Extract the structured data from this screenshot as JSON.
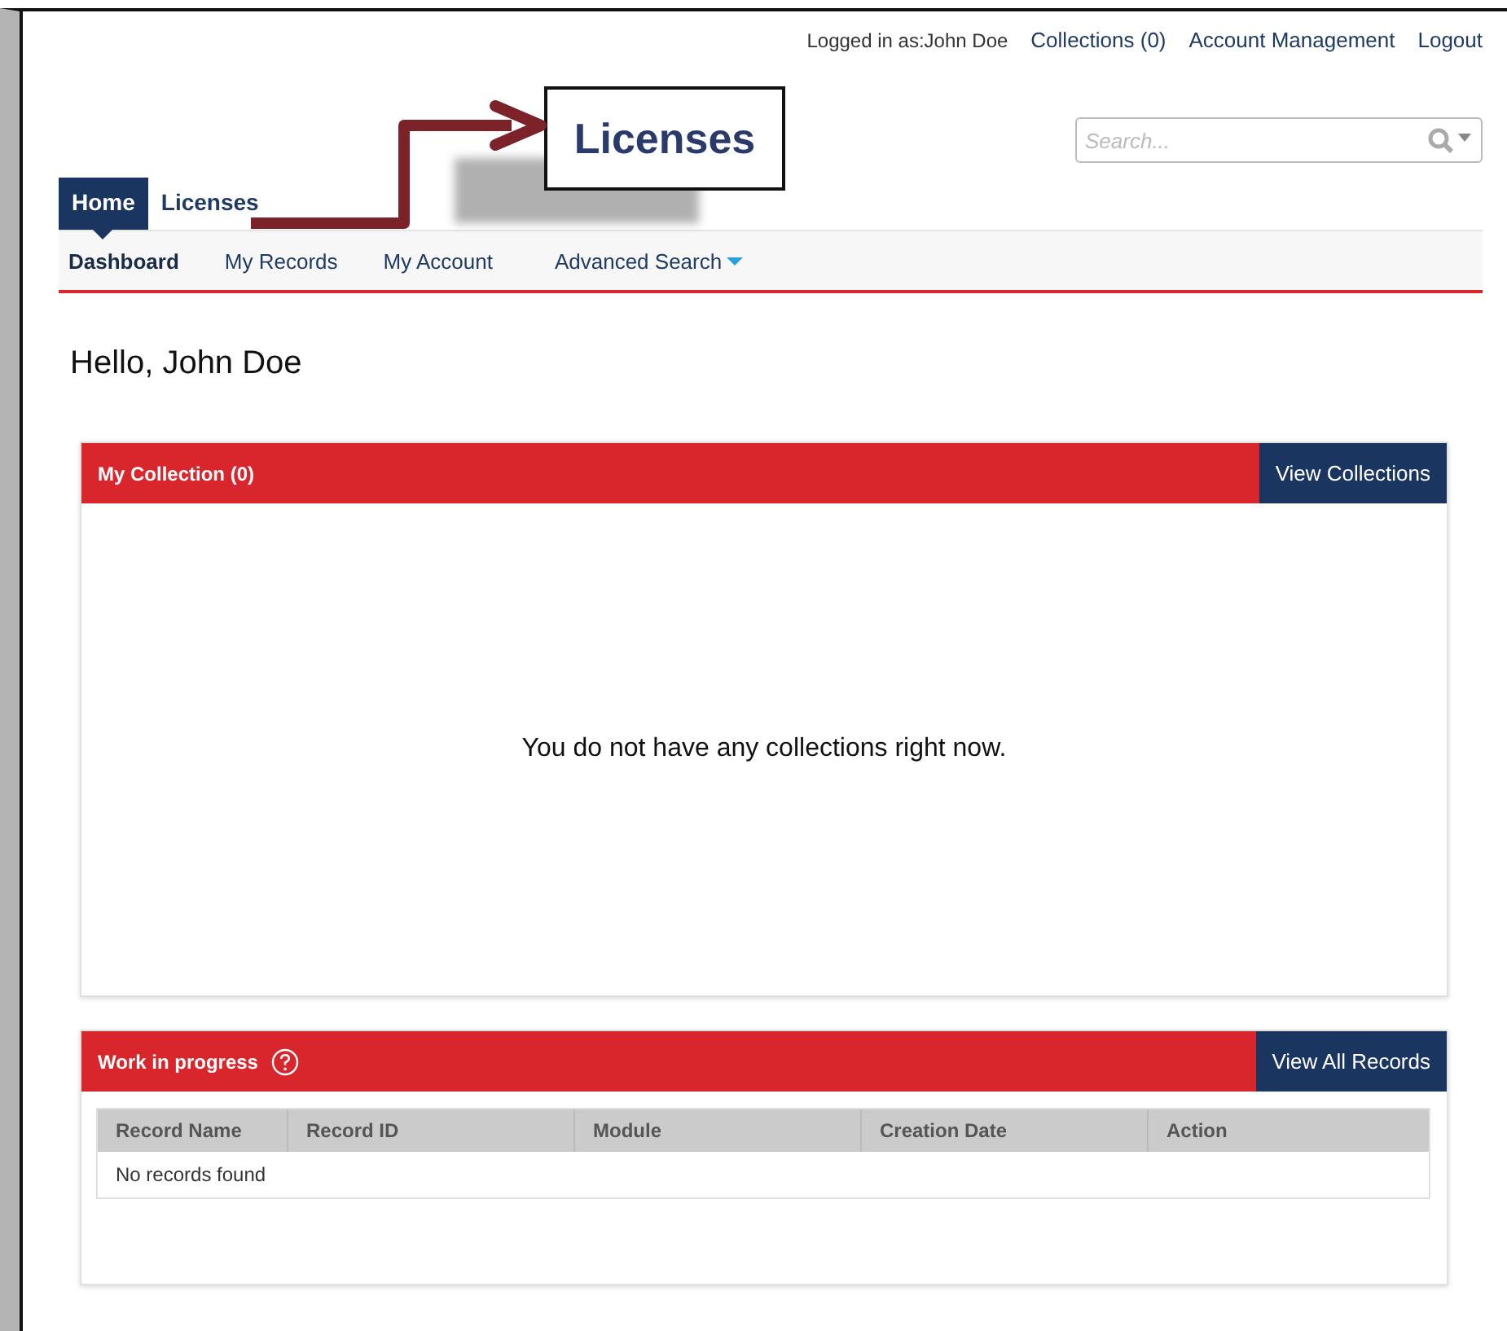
{
  "top_links": [
    {
      "kind": "text",
      "label": "Logged in as:John Doe"
    },
    {
      "kind": "link",
      "label": "Collections (0)"
    },
    {
      "kind": "link",
      "label": "Account Management"
    },
    {
      "kind": "link",
      "label": "Logout"
    }
  ],
  "callout": {
    "label": "Licenses"
  },
  "search": {
    "placeholder": "Search..."
  },
  "tabs": [
    {
      "label": "Home",
      "selected": true
    },
    {
      "label": "Licenses",
      "selected": false
    }
  ],
  "subnav": [
    {
      "label": "Dashboard",
      "selected": true,
      "dropdown": false
    },
    {
      "label": "My Records",
      "selected": false,
      "dropdown": false
    },
    {
      "label": "My Account",
      "selected": false,
      "dropdown": false
    },
    {
      "label": "Advanced Search",
      "selected": false,
      "dropdown": true
    }
  ],
  "greeting": "Hello, John Doe",
  "collection_panel": {
    "title": "My Collection (0)",
    "help": false,
    "button": "View Collections",
    "message": "You do not have any collections right now."
  },
  "work_panel": {
    "title": "Work in progress",
    "help": true,
    "button": "View All Records",
    "table": {
      "columns": [
        "Record Name",
        "Record ID",
        "Module",
        "Creation Date",
        "Action"
      ],
      "empty": "No records found"
    }
  }
}
